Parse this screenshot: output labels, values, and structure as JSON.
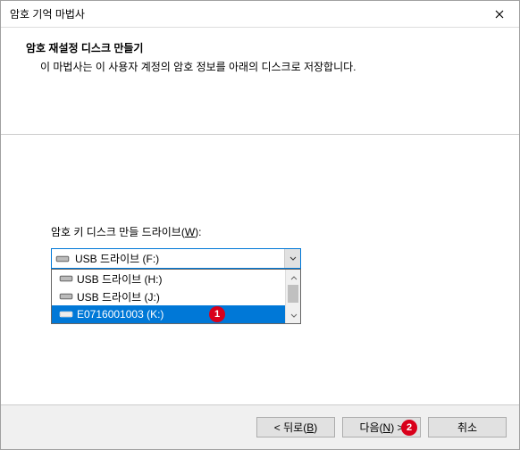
{
  "window": {
    "title": "암호 기억 마법사"
  },
  "header": {
    "title": "암호 재설정 디스크 만들기",
    "description": "이 마법사는 이 사용자 계정의 암호 정보를 아래의 디스크로 저장합니다."
  },
  "content": {
    "field_label_pre": "암호 키 디스크 만들 드라이브(",
    "field_label_accel": "W",
    "field_label_post": "):",
    "combobox": {
      "selected": "USB 드라이브 (F:)",
      "options": [
        {
          "label": "USB 드라이브 (H:)",
          "selected": false
        },
        {
          "label": "USB 드라이브 (J:)",
          "selected": false
        },
        {
          "label": "E0716001003 (K:)",
          "selected": true
        }
      ]
    }
  },
  "buttons": {
    "back_pre": "< 뒤로(",
    "back_accel": "B",
    "back_post": ")",
    "next_pre": "다음(",
    "next_accel": "N",
    "next_post": ") >",
    "cancel": "취소"
  },
  "badges": {
    "b1": "1",
    "b2": "2"
  }
}
